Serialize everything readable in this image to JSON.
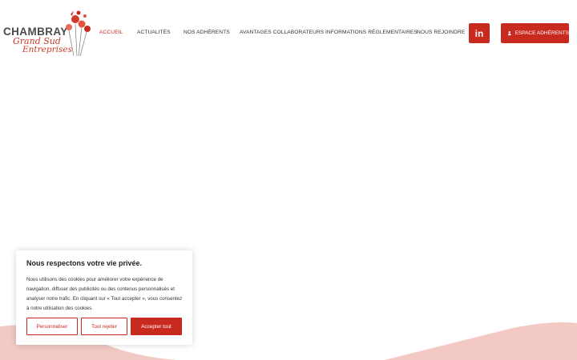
{
  "logo": {
    "name": "CHAMBRAY",
    "line2": "Grand Sud",
    "line3": "Entreprises"
  },
  "nav": {
    "items": [
      {
        "label": "Accueil",
        "active": true
      },
      {
        "label": "Actualités"
      },
      {
        "label": "Nos adhérents"
      },
      {
        "label": "Avantages collaborateurs"
      },
      {
        "label": "Informations réglementaires"
      },
      {
        "label": "Nous rejoindre"
      }
    ]
  },
  "header_actions": {
    "linkedin_icon": "linkedin-icon",
    "linkedin_glyph": "in",
    "member_label": "Espace adhérents",
    "member_icon": "user-icon"
  },
  "cookie_banner": {
    "title": "Nous respectons votre vie privée.",
    "text": "Nous utilisons des cookies pour améliorer votre expérience de navigation, diffuser des publicités ou des contenus personnalisés et analyser notre trafic. En cliquant sur « Tout accepter », vous consentez à notre utilisation des cookies.",
    "customize_label": "Personnaliser",
    "reject_label": "Tout rejeter",
    "accept_label": "Accepter tout"
  },
  "colors": {
    "accent": "#c82a20",
    "wave": "#f2c9c3"
  }
}
